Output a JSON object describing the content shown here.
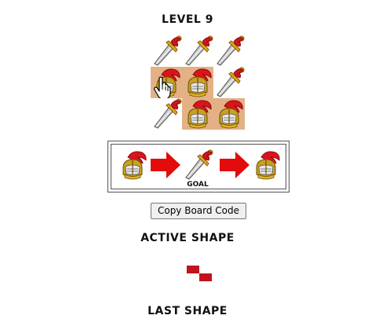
{
  "level": {
    "title": "LEVEL 9"
  },
  "board": {
    "rows": 3,
    "cols": 3,
    "cells": [
      [
        "sword",
        "sword",
        "sword"
      ],
      [
        "helmet",
        "helmet",
        "sword"
      ],
      [
        "sword",
        "helmet",
        "helmet"
      ]
    ],
    "highlighted": [
      [
        1,
        0
      ],
      [
        1,
        1
      ],
      [
        2,
        1
      ],
      [
        2,
        2
      ]
    ]
  },
  "goal": {
    "sequence": [
      "helmet",
      "arrow",
      "sword",
      "arrow",
      "helmet"
    ],
    "label": "GOAL"
  },
  "controls": {
    "copy_label": "Copy Board Code"
  },
  "active_shape": {
    "title": "ACTIVE SHAPE",
    "color": "#c0141e",
    "cells": [
      [
        0,
        0
      ],
      [
        1,
        1
      ]
    ]
  },
  "last_shape": {
    "title": "LAST SHAPE"
  },
  "colors": {
    "highlight": "#e3b184",
    "arrow": "#e30b0b"
  }
}
